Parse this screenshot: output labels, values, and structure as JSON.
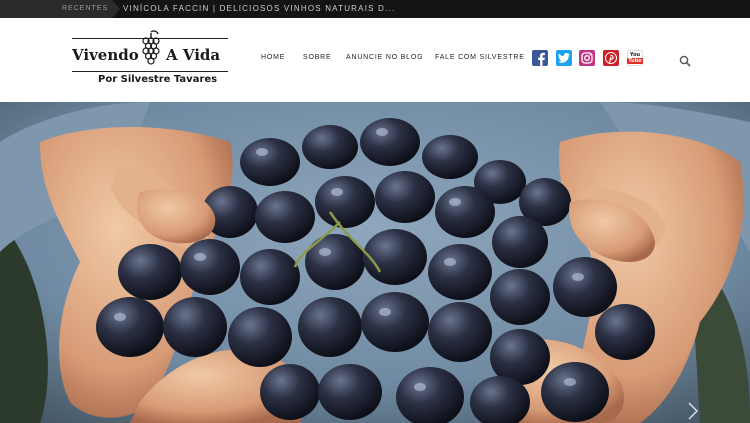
{
  "ticker": {
    "label": "Recentes",
    "headline": "VINÍCOLA FACCIN | DELICIOSOS VINHOS NATURAIS D..."
  },
  "logo": {
    "title_left": "Vivendo",
    "title_right": "A Vida",
    "subtitle": "Por Silvestre Tavares"
  },
  "nav": {
    "items": [
      {
        "label": "HOME"
      },
      {
        "label": "SOBRE"
      },
      {
        "label": "ANUNCIE NO BLOG"
      },
      {
        "label": "FALE COM SILVESTRE"
      }
    ]
  },
  "social": [
    {
      "icon": "facebook-icon",
      "color": "#3b5998"
    },
    {
      "icon": "twitter-icon",
      "color": "#1da1f2"
    },
    {
      "icon": "instagram-icon",
      "color": "#c13584"
    },
    {
      "icon": "pinterest-icon",
      "color": "#cb2027"
    },
    {
      "icon": "youtube-icon",
      "color": "#e52d27",
      "text": "You Tube"
    }
  ],
  "hero": {
    "image": "hands-holding-purple-grapes"
  }
}
